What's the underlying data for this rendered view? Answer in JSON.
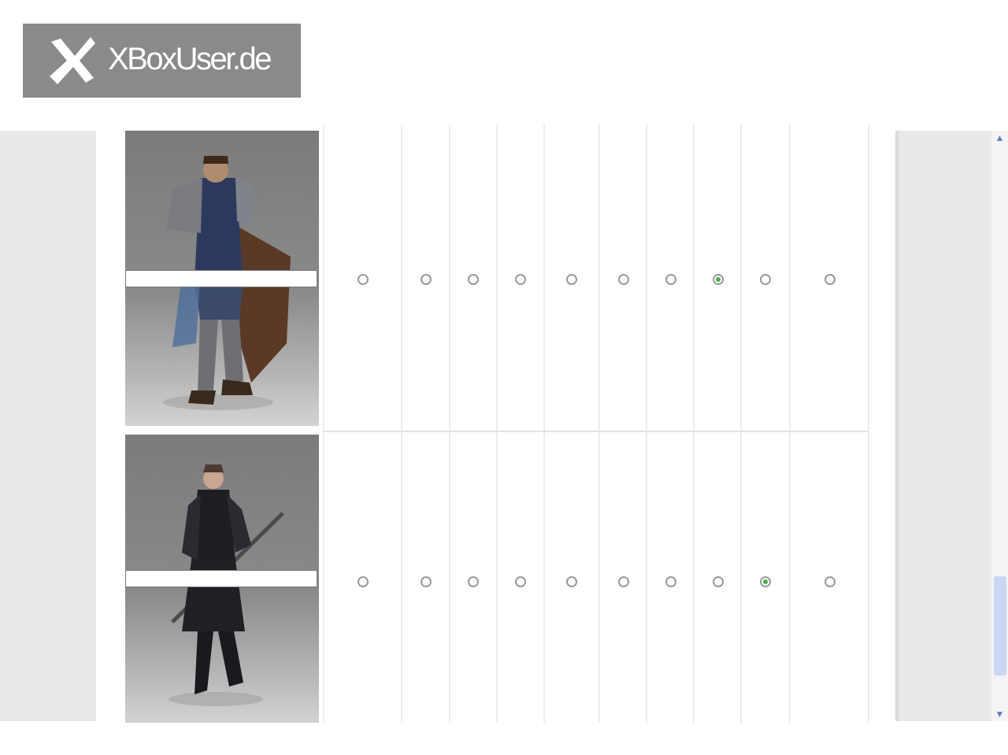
{
  "logo": {
    "text": "XBoxUser.de",
    "icon": "x-logo-icon",
    "bg_color": "#8a8a8a"
  },
  "survey": {
    "rows": [
      {
        "character": "armored-warrior-with-shield",
        "name_value": "",
        "selected_index": 7
      },
      {
        "character": "dark-armored-swordswoman",
        "name_value": "",
        "selected_index": 8
      }
    ],
    "options_count": 10,
    "selected_color": "#4cae4c"
  },
  "scrollbar": {
    "up_icon": "chevron-up-icon",
    "down_icon": "chevron-down-icon",
    "position": 0.75
  }
}
